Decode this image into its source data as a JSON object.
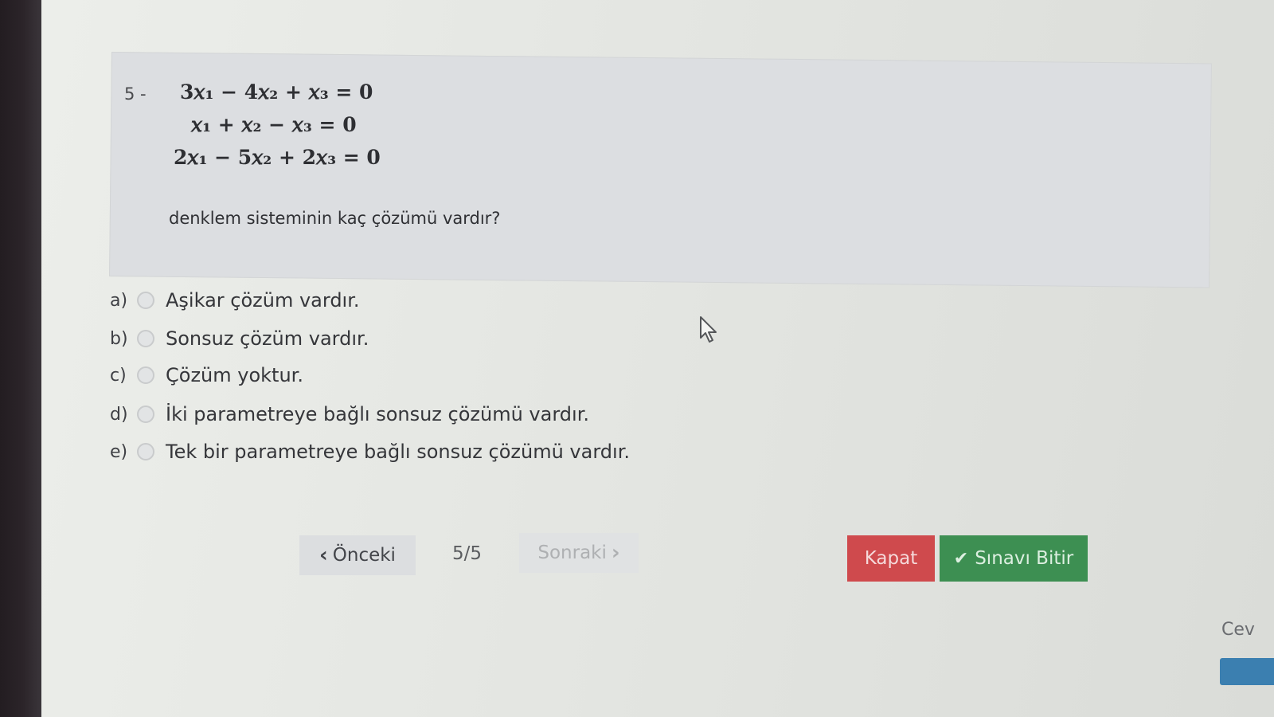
{
  "question": {
    "number": "5 -",
    "equations": [
      "3𝑥₁ − 4𝑥₂ + 𝑥₃ = 0",
      "𝑥₁ + 𝑥₂ − 𝑥₃ = 0",
      "2𝑥₁ − 5𝑥₂ + 2𝑥₃ = 0"
    ],
    "text": "denklem sisteminin kaç çözümü vardır?"
  },
  "options": [
    {
      "letter": "a)",
      "text": "Aşikar çözüm vardır."
    },
    {
      "letter": "b)",
      "text": "Sonsuz çözüm vardır."
    },
    {
      "letter": "c)",
      "text": "Çözüm yoktur."
    },
    {
      "letter": "d)",
      "text": "İki parametreye bağlı sonsuz çözümü vardır."
    },
    {
      "letter": "e)",
      "text": "Tek bir parametreye bağlı sonsuz çözümü vardır."
    }
  ],
  "navigation": {
    "prev_label": "Önceki",
    "page_counter": "5/5",
    "next_label": "Sonraki"
  },
  "actions": {
    "close_label": "Kapat",
    "finish_label": "Sınavı Bitir"
  },
  "edge": {
    "partial_text": "Cev"
  },
  "colors": {
    "close": "#cf4a4d",
    "finish": "#3d8f52",
    "panel": "#dcdee1"
  }
}
